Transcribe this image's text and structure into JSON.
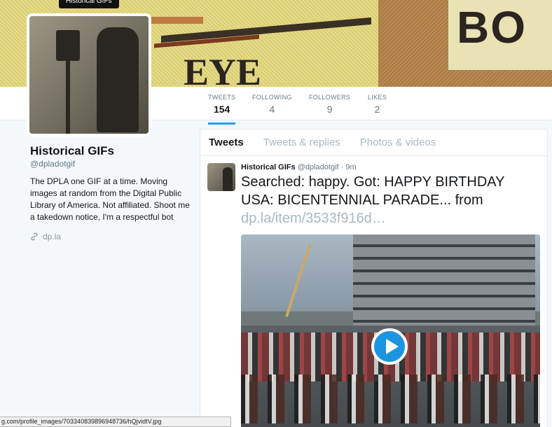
{
  "tooltip": "Historical GIFs",
  "banner": {
    "eye_text": "EYE",
    "box_text": "BO"
  },
  "nav": {
    "stats": [
      {
        "label": "TWEETS",
        "value": "154"
      },
      {
        "label": "FOLLOWING",
        "value": "4"
      },
      {
        "label": "FOLLOWERS",
        "value": "9"
      },
      {
        "label": "LIKES",
        "value": "2"
      }
    ],
    "active_color": "#1da1f2"
  },
  "profile": {
    "name": "Historical GIFs",
    "handle": "@dpladotgif",
    "bio": "The DPLA one GIF at a time. Moving images at random from the Digital Public Library of America. Not affiliated. Shoot me a takedown notice, I'm a respectful bot",
    "link": "dp.la",
    "link_icon": "link-icon"
  },
  "timeline": {
    "tabs": [
      "Tweets",
      "Tweets & replies",
      "Photos & videos"
    ],
    "tweet": {
      "name": "Historical GIFs",
      "handle": "@dpladotgif",
      "separator": "·",
      "time": "9m",
      "text": "Searched: happy. Got: HAPPY BIRTHDAY USA: BICENTENNIAL PARADE... from",
      "link": "dp.la/item/3533f916d…",
      "media_icon": "play-icon"
    }
  },
  "statusbar": {
    "url": "g.com/profile_images/703340839896948736/hQjvidtV.jpg"
  }
}
